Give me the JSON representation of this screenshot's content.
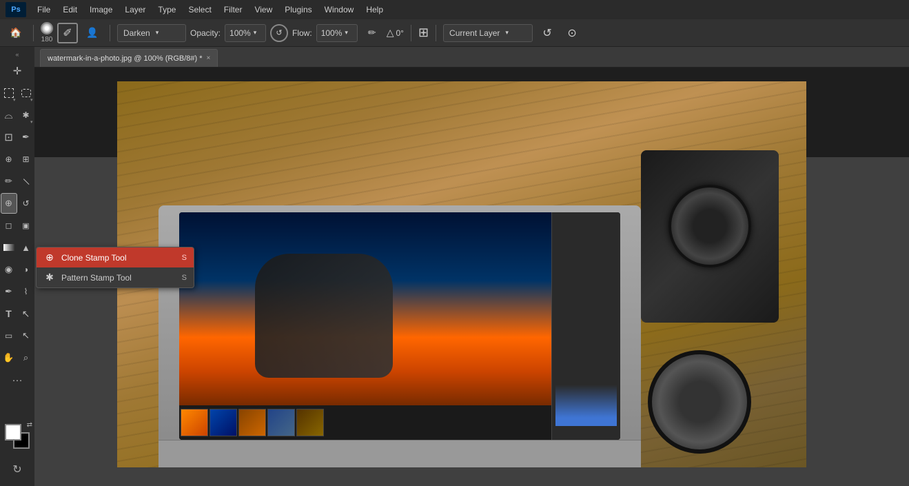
{
  "app": {
    "logo": "Ps",
    "logo_color": "#4da8ff"
  },
  "menu": {
    "items": [
      "File",
      "Edit",
      "Image",
      "Layer",
      "Type",
      "Select",
      "Filter",
      "View",
      "Plugins",
      "Window",
      "Help"
    ]
  },
  "options_bar": {
    "brush_size": "180",
    "blend_mode": "Darken",
    "blend_mode_arrow": "▾",
    "opacity_label": "Opacity:",
    "opacity_value": "100%",
    "flow_label": "Flow:",
    "flow_value": "100%",
    "angle_value": "0°",
    "layer_dropdown": "Current Layer",
    "layer_arrow": "▾"
  },
  "tab": {
    "title": "watermark-in-a-photo.jpg @ 100% (RGB/8#) *",
    "close": "×"
  },
  "toolbar": {
    "tools": [
      {
        "name": "move",
        "icon": "✛",
        "has_arrow": false
      },
      {
        "name": "rect-select",
        "icon": "⬚",
        "has_arrow": true
      },
      {
        "name": "lasso",
        "icon": "⌓",
        "has_arrow": false
      },
      {
        "name": "magic-select",
        "icon": "⬚",
        "has_arrow": true
      },
      {
        "name": "crop",
        "icon": "⊡",
        "has_arrow": false
      },
      {
        "name": "eyedropper",
        "icon": "✒",
        "has_arrow": false
      },
      {
        "name": "spot-heal",
        "icon": "⊕",
        "has_arrow": false
      },
      {
        "name": "brush",
        "icon": "✏",
        "has_arrow": false
      },
      {
        "name": "clone-stamp",
        "icon": "⊕",
        "has_arrow": false,
        "active": true
      },
      {
        "name": "history-brush",
        "icon": "↺",
        "has_arrow": false
      },
      {
        "name": "eraser",
        "icon": "◻",
        "has_arrow": false
      },
      {
        "name": "gradient",
        "icon": "▭",
        "has_arrow": false
      },
      {
        "name": "blur",
        "icon": "◉",
        "has_arrow": false
      },
      {
        "name": "dodge",
        "icon": "◑",
        "has_arrow": false
      },
      {
        "name": "pen",
        "icon": "✒",
        "has_arrow": false
      },
      {
        "name": "type",
        "icon": "T",
        "has_arrow": false
      },
      {
        "name": "path-select",
        "icon": "↖",
        "has_arrow": false
      },
      {
        "name": "shape",
        "icon": "▭",
        "has_arrow": false
      },
      {
        "name": "hand",
        "icon": "✋",
        "has_arrow": false
      },
      {
        "name": "zoom",
        "icon": "⌕",
        "has_arrow": false
      }
    ]
  },
  "flyout": {
    "items": [
      {
        "label": "Clone Stamp Tool",
        "shortcut": "S",
        "selected": true
      },
      {
        "label": "Pattern Stamp Tool",
        "shortcut": "S",
        "selected": false
      }
    ]
  },
  "colors": {
    "fg": "#ffffff",
    "bg": "#000000"
  }
}
